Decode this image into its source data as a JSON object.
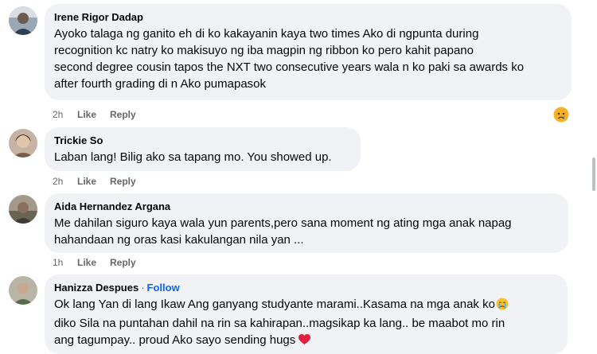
{
  "comments": [
    {
      "author": "Irene Rigor Dadap",
      "text_lines": [
        "Ayoko talaga ng ganito eh di ko kakayanin kaya two times Ako di ngpunta during",
        "recognition kc natry ko makisuyo ng iba magpin ng ribbon ko pero kahit papano",
        "second degree cousin tapos the NXT two consecutive years wala n ko paki sa awards ko",
        "after fourth grading di n Ako pumapasok"
      ],
      "time": "2h",
      "like_label": "Like",
      "reply_label": "Reply",
      "reaction_icon": "sad-reaction-icon"
    },
    {
      "author": "Trickie So",
      "text_lines": [
        "Laban lang! Bilig ako sa tapang mo. You showed up."
      ],
      "time": "2h",
      "like_label": "Like",
      "reply_label": "Reply"
    },
    {
      "author": "Aida Hernandez Argana",
      "text_lines": [
        "Me dahilan siguro kaya wala yun parents,pero sana moment ng ating mga anak napag",
        "hahandaan ng oras kasi kakulangan nila yan ..."
      ],
      "time": "1h",
      "like_label": "Like",
      "reply_label": "Reply"
    },
    {
      "author": "Hanizza Despues",
      "follow_label": "Follow",
      "text_lines": [
        "Ok lang Yan di lang Ikaw Ang ganyang studyante marami..Kasama na mga anak ko",
        "diko Sila na puntahan dahil na rin sa kahirapan..magsikap ka lang.. be maabot mo rin",
        "ang tagumpay.. proud Ako sayo sending hugs"
      ],
      "inline_icons": [
        "crying-face-emoji-icon",
        "red-heart-emoji-icon"
      ]
    }
  ],
  "colors": {
    "bubble": "#f0f2f5",
    "text": "#050505",
    "meta": "#65676b",
    "follow": "#0866ff",
    "heart": "#e41e3f"
  }
}
